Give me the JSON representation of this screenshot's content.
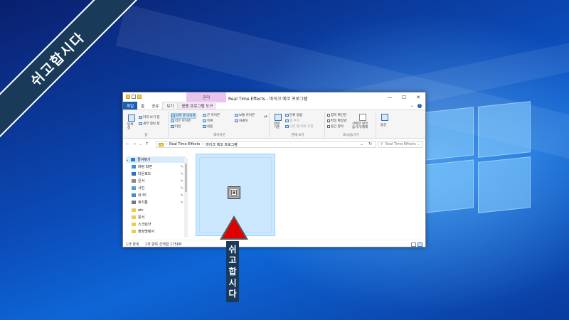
{
  "banner": {
    "text": "쉬고합시다"
  },
  "window": {
    "title": "Real Time Effects - 마이크 에코 프로그램",
    "context_tab_header": "관리",
    "controls": [
      "—",
      "☐",
      "✕"
    ]
  },
  "ribbon_tabs": [
    {
      "label": "파일"
    },
    {
      "label": "홈"
    },
    {
      "label": "공유"
    },
    {
      "label": "보기"
    },
    {
      "label": "응용 프로그램 도구"
    }
  ],
  "ribbon": {
    "pane_group": {
      "label": "창",
      "nav_pane": "탐색\n창",
      "preview": "미리 보기 창",
      "details": "세부 정보 창"
    },
    "layout_group": {
      "label": "레이아웃",
      "items": [
        "아주 큰 아이콘",
        "큰 아이콘",
        "보통 아이콘",
        "작은 아이콘",
        "목록",
        "자세히",
        "타일",
        "내용"
      ]
    },
    "current_view_group": {
      "label": "현재 보기",
      "sort": "정렬\n기준",
      "group_by": "분류 방법",
      "add_columns": "열 추가",
      "fit_columns": "모든 열 너비 조정"
    },
    "show_hide_group": {
      "label": "표시/숨기기",
      "item_checkbox": "항목 확인란",
      "file_ext": "파일 확장명",
      "hidden_items": "숨긴 항목",
      "hide_selected": "선택한 항목\n숨기기/해제",
      "options": "옵션"
    }
  },
  "address": {
    "path": [
      "Real Time Effects",
      "마이크 에코 프로그램"
    ],
    "search_placeholder": "Real Time Effects ..."
  },
  "nav_pane": {
    "items": [
      {
        "label": "즐겨찾기",
        "icon": "star-icon",
        "color": "#2b7bd6",
        "pinned": false,
        "selected": true
      },
      {
        "label": "바탕 화면",
        "icon": "desktop-icon",
        "color": "#3c8fe0",
        "pinned": true,
        "selected": false
      },
      {
        "label": "다운로드",
        "icon": "download-icon",
        "color": "#2a6fc9",
        "pinned": true,
        "selected": false
      },
      {
        "label": "문서",
        "icon": "document-icon",
        "color": "#8a8a8a",
        "pinned": true,
        "selected": false
      },
      {
        "label": "사진",
        "icon": "picture-icon",
        "color": "#4a9fe0",
        "pinned": true,
        "selected": false
      },
      {
        "label": "내 PC",
        "icon": "computer-icon",
        "color": "#3c8fe0",
        "pinned": true,
        "selected": false
      },
      {
        "label": "휴지통",
        "icon": "recycle-bin-icon",
        "color": "#777777",
        "pinned": true,
        "selected": false
      },
      {
        "label": "etc",
        "icon": "folder-icon",
        "color": "#f2c94c",
        "pinned": false,
        "selected": false
      },
      {
        "label": "문서",
        "icon": "folder-icon",
        "color": "#f2c94c",
        "pinned": false,
        "selected": false
      },
      {
        "label": "스크린샷",
        "icon": "folder-icon",
        "color": "#f2c94c",
        "pinned": false,
        "selected": false
      },
      {
        "label": "출장명령서",
        "icon": "folder-icon",
        "color": "#f2c94c",
        "pinned": false,
        "selected": false
      }
    ]
  },
  "status": {
    "count": "1개 항목",
    "selection": "1개 항목 선택함 175KB"
  },
  "overlay": {
    "vertical_text": [
      "쉬",
      "고",
      "합",
      "시",
      "다"
    ]
  },
  "colors": {
    "accent": "#1a5fb4",
    "selection": "#cce8ff",
    "arrow": "#e00000",
    "label_bg": "#1a3a5a"
  }
}
